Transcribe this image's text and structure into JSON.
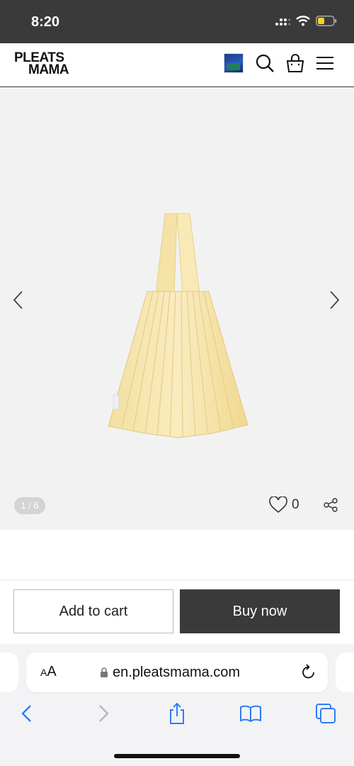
{
  "status_bar": {
    "time": "8:20"
  },
  "header": {
    "logo_line1": "PLEATS",
    "logo_line2": "MAMA"
  },
  "gallery": {
    "counter": "1 / 6",
    "like_count": "0"
  },
  "actions": {
    "add_to_cart": "Add to cart",
    "buy_now": "Buy now"
  },
  "browser": {
    "text_size_label_small": "A",
    "text_size_label_large": "A",
    "url": "en.pleatsmama.com"
  },
  "colors": {
    "status_bar_bg": "#3a3a3a",
    "gallery_bg": "#f2f2f2",
    "buy_button_bg": "#3a3a3a",
    "bag_color": "#f6e3a8",
    "ios_blue": "#2f7cf6"
  }
}
